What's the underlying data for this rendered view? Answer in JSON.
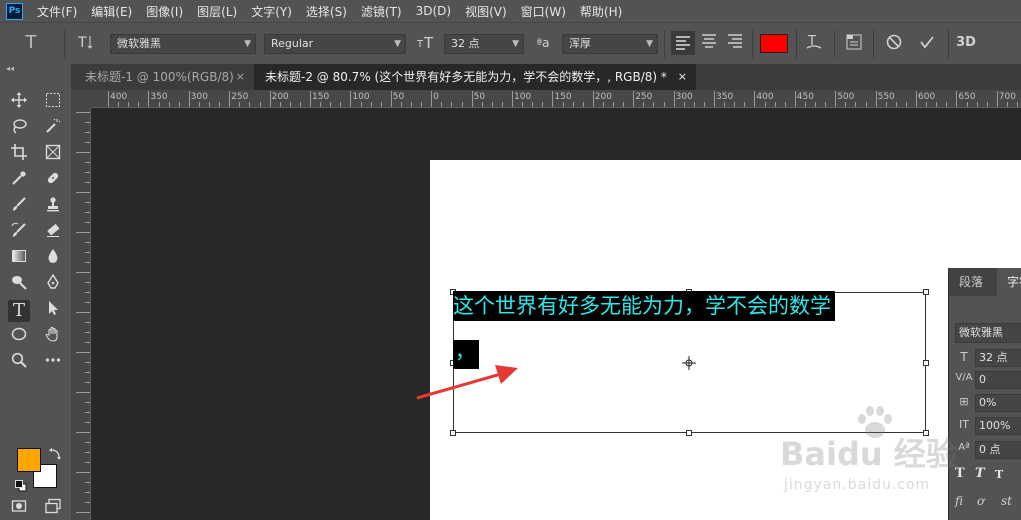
{
  "app": {
    "logo": "Ps"
  },
  "menu": [
    "文件(F)",
    "编辑(E)",
    "图像(I)",
    "图层(L)",
    "文字(Y)",
    "选择(S)",
    "滤镜(T)",
    "3D(D)",
    "视图(V)",
    "窗口(W)",
    "帮助(H)"
  ],
  "options": {
    "tool_glyph": "T",
    "font_family": "微软雅黑",
    "font_style": "Regular",
    "font_size": "32 点",
    "aa_glyph": "ªa",
    "antialias": "浑厚",
    "color": "#ff0000",
    "threed": "3D"
  },
  "tabs": [
    {
      "label": "未标题-1 @ 100%(RGB/8)",
      "close": "×"
    },
    {
      "label": "未标题-2 @ 80.7% (这个世界有好多无能为力，学不会的数学，, RGB/8) *",
      "close": "×"
    }
  ],
  "ruler": {
    "top_labels": [
      "400",
      "350",
      "300",
      "250",
      "200",
      "150",
      "100",
      "50",
      "0",
      "50",
      "100",
      "150",
      "200",
      "250",
      "300",
      "350",
      "400",
      "450",
      "500",
      "550",
      "600",
      "650",
      "700"
    ]
  },
  "canvas": {
    "text_line1": "这个世界有好多无能为力，学不会的数学",
    "text_line2": "，"
  },
  "colors": {
    "foreground": "#ffa500",
    "background": "#ffffff",
    "selection_text": "#31e6ea"
  },
  "character_panel": {
    "tabs": [
      "段落",
      "字符"
    ],
    "font": "微软雅黑",
    "size": "32 点",
    "kerning": "0",
    "tracking": "0%",
    "vscale": "100%",
    "baseline": "0 点",
    "labels": {
      "size": "T",
      "kerning": "V/A",
      "tracking": "⊞",
      "vscale": "IT",
      "baseline": "Aª"
    },
    "styles": [
      "T",
      "T",
      "T"
    ],
    "ligatures": [
      "fi",
      "ơ",
      "st"
    ]
  },
  "watermark": {
    "main": "Baidu 经验",
    "sub": "jingyan.baidu.com"
  }
}
